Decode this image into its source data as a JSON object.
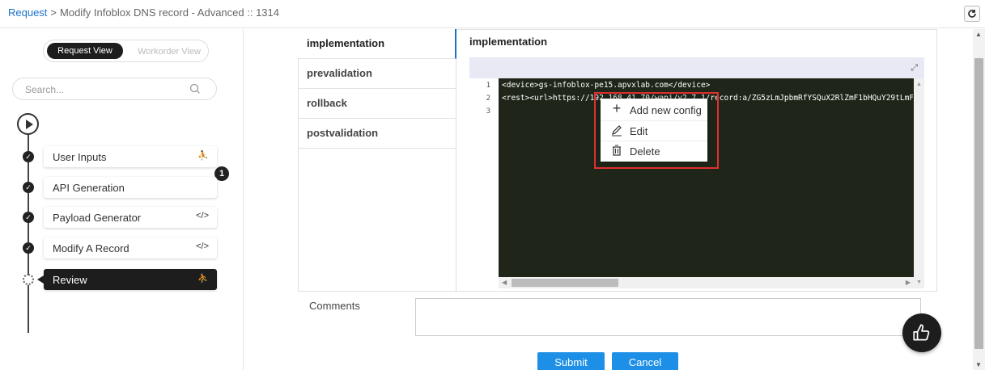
{
  "breadcrumb": {
    "root": "Request",
    "separator": ">",
    "current": "Modify Infoblox DNS record - Advanced :: 1314"
  },
  "sidebar": {
    "view_toggle": {
      "active": "Request View",
      "inactive": "Workorder View"
    },
    "search_placeholder": "Search...",
    "steps": [
      {
        "label": "User Inputs",
        "icon": "user-icon",
        "status": "done"
      },
      {
        "label": "API Generation",
        "icon": "",
        "status": "done"
      },
      {
        "label": "Payload Generator",
        "icon": "code-icon",
        "status": "done"
      },
      {
        "label": "Modify A Record",
        "icon": "code-icon",
        "status": "done"
      },
      {
        "label": "Review",
        "icon": "user-icon",
        "status": "in-progress"
      }
    ],
    "badge": "1"
  },
  "tabs": [
    "implementation",
    "prevalidation",
    "rollback",
    "postvalidation"
  ],
  "editor": {
    "title": "implementation",
    "lines": [
      {
        "n": "1",
        "text": "<device>gs-infoblox-pe15.apvxlab.com</device>"
      },
      {
        "n": "2",
        "text": "<rest><url>https://192.168.41.70/wapi/v2.7.1/record:a/ZG5zLmJpbmRfYSQuX2RlZmF1bHQuY29tLmF"
      },
      {
        "n": "3",
        "text": ""
      }
    ]
  },
  "context_menu": {
    "items": [
      {
        "label": "Add new config",
        "icon": "plus-icon"
      },
      {
        "label": "Edit",
        "icon": "pencil-icon"
      },
      {
        "label": "Delete",
        "icon": "trash-icon"
      }
    ]
  },
  "comments": {
    "label": "Comments",
    "value": ""
  },
  "buttons": {
    "submit": "Submit",
    "cancel": "Cancel"
  },
  "colors": {
    "accent": "#1e8fe6",
    "link": "#1a73c9",
    "dark": "#1d1d1d",
    "editor_bg": "#1f2619",
    "highlight": "#e03030"
  }
}
